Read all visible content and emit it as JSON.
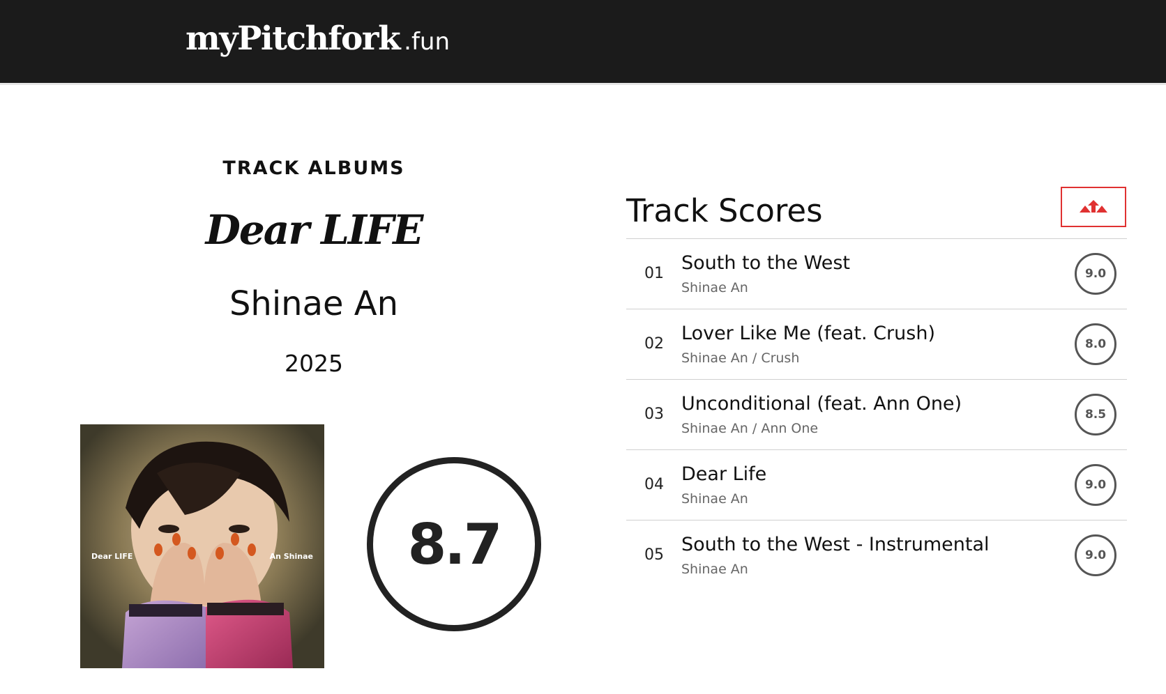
{
  "header": {
    "logo_main": "myPitchfork",
    "logo_sub": ".fun"
  },
  "album": {
    "section_label": "TRACK ALBUMS",
    "title": "Dear LIFE",
    "artist": "Shinae An",
    "year": "2025",
    "score": "8.7",
    "cover_text_left": "Dear LIFE",
    "cover_text_right": "An Shinae"
  },
  "tracks": {
    "heading": "Track Scores",
    "sort_icon": "sort-arrows-icon",
    "accent_color": "#e03131",
    "items": [
      {
        "num": "01",
        "title": "South to the West",
        "artist": "Shinae An",
        "score": "9.0"
      },
      {
        "num": "02",
        "title": "Lover Like Me (feat. Crush)",
        "artist": "Shinae An / Crush",
        "score": "8.0"
      },
      {
        "num": "03",
        "title": "Unconditional (feat. Ann One)",
        "artist": "Shinae An / Ann One",
        "score": "8.5"
      },
      {
        "num": "04",
        "title": "Dear Life",
        "artist": "Shinae An",
        "score": "9.0"
      },
      {
        "num": "05",
        "title": "South to the West - Instrumental",
        "artist": "Shinae An",
        "score": "9.0"
      }
    ]
  }
}
